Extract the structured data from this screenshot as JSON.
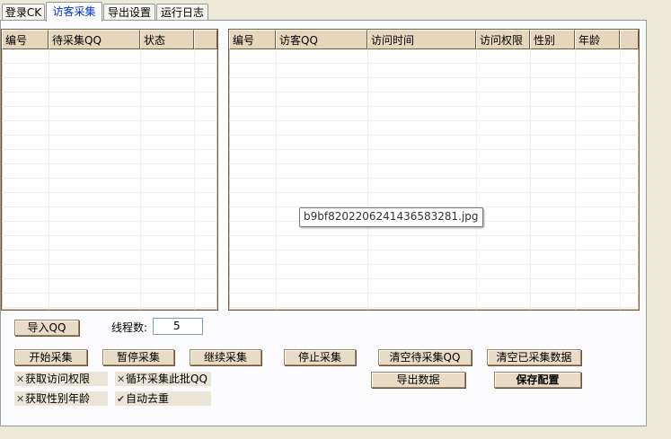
{
  "tabs": [
    {
      "label": "登录CK",
      "active": false
    },
    {
      "label": "访客采集",
      "active": true
    },
    {
      "label": "导出设置",
      "active": false
    },
    {
      "label": "运行日志",
      "active": false
    }
  ],
  "left_grid": {
    "columns": [
      "编号",
      "待采集QQ",
      "状态",
      ""
    ]
  },
  "right_grid": {
    "columns": [
      "编号",
      "访客QQ",
      "访问时间",
      "访问权限",
      "性别",
      "年龄",
      ""
    ]
  },
  "tooltip": "b9bf8202206241436583281.jpg",
  "controls": {
    "import_qq": "导入QQ",
    "thread_label": "线程数:",
    "thread_value": "5",
    "start": "开始采集",
    "pause": "暂停采集",
    "resume": "继续采集",
    "stop": "停止采集",
    "clear_pending": "清空待采集QQ",
    "clear_collected": "清空已采集数据",
    "export": "导出数据",
    "save_config": "保存配置"
  },
  "checkboxes": [
    {
      "label": "获取访问权限",
      "checked": false,
      "mark": "✕"
    },
    {
      "label": "循环采集此批QQ",
      "checked": false,
      "mark": "✕"
    },
    {
      "label": "获取性别年龄",
      "checked": false,
      "mark": "✕"
    },
    {
      "label": "自动去重",
      "checked": true,
      "mark": "✔"
    }
  ],
  "colors": {
    "header_bg": "#e6d6bc",
    "button_bg": "#e8dcc6",
    "active_tab_text": "#0033cc"
  }
}
